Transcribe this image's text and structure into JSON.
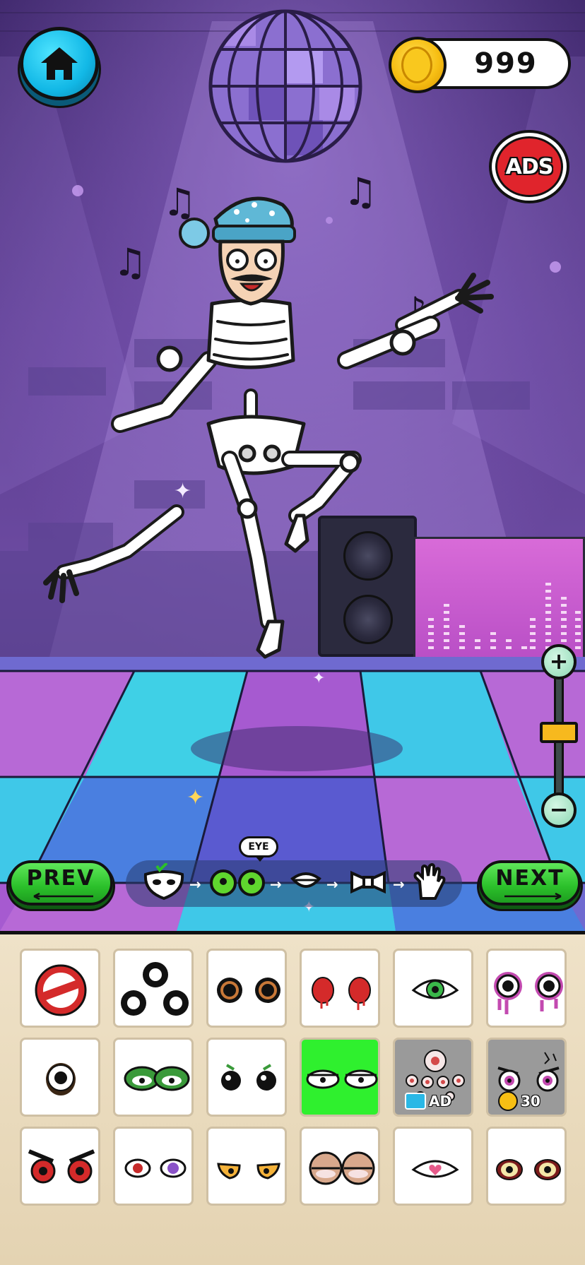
{
  "hud": {
    "coins": "999",
    "ads_label": "ADS"
  },
  "steps": {
    "current_label": "EYE",
    "items": [
      "mask-icon",
      "eye-icon",
      "mouth-icon",
      "bow-icon",
      "glove-icon"
    ]
  },
  "nav": {
    "prev_label": "PREV",
    "next_label": "NEXT"
  },
  "palette": {
    "items": [
      {
        "name": "none-option",
        "lock": ""
      },
      {
        "name": "three-black-eyes",
        "lock": ""
      },
      {
        "name": "orange-ring-eyes",
        "lock": ""
      },
      {
        "name": "red-dripping-eyes",
        "lock": ""
      },
      {
        "name": "green-single-eye",
        "lock": ""
      },
      {
        "name": "purple-dripping-eyes",
        "lock": ""
      },
      {
        "name": "cyclops-eye",
        "lock": ""
      },
      {
        "name": "frog-eyes",
        "lock": ""
      },
      {
        "name": "black-bead-eyes",
        "lock": ""
      },
      {
        "name": "green-bored-eyes",
        "lock": "",
        "selected": true
      },
      {
        "name": "multi-eye-cluster",
        "lock": "AD"
      },
      {
        "name": "angry-cracked-eyes",
        "lock": "30"
      },
      {
        "name": "red-angry-eyes",
        "lock": ""
      },
      {
        "name": "red-purple-eyes",
        "lock": ""
      },
      {
        "name": "yellow-cat-eyes",
        "lock": ""
      },
      {
        "name": "sleepy-pink-eyes",
        "lock": ""
      },
      {
        "name": "heart-pupil-eye",
        "lock": ""
      },
      {
        "name": "yellow-red-rim-eyes",
        "lock": ""
      }
    ]
  },
  "colors": {
    "accent_green": "#2bc02a",
    "home_blue": "#12b8e6",
    "coin_gold": "#f7bf14",
    "ads_red": "#e0242c"
  }
}
